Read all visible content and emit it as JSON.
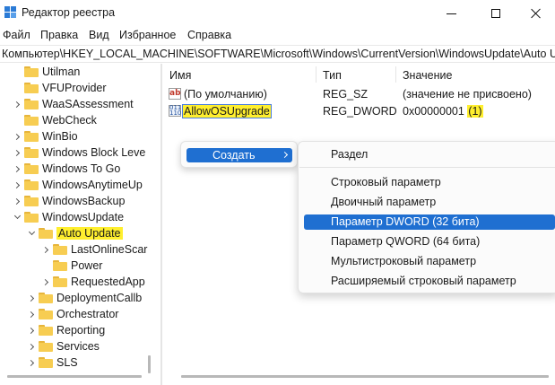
{
  "window": {
    "title": "Редактор реестра",
    "icon": "registry-editor-icon",
    "accent": "#1f6fd1"
  },
  "menu": [
    "Файл",
    "Правка",
    "Вид",
    "Избранное",
    "Справка"
  ],
  "address": "Компьютер\\HKEY_LOCAL_MACHINE\\SOFTWARE\\Microsoft\\Windows\\CurrentVersion\\WindowsUpdate\\Auto Update",
  "tree": {
    "items": [
      {
        "label": "Utilman"
      },
      {
        "label": "VFUProvider"
      },
      {
        "label": "WaaSAssessment"
      },
      {
        "label": "WebCheck"
      },
      {
        "label": "WinBio"
      },
      {
        "label": "Windows Block Leve"
      },
      {
        "label": "Windows To Go"
      },
      {
        "label": "WindowsAnytimeUp"
      },
      {
        "label": "WindowsBackup"
      },
      {
        "label": "WindowsUpdate"
      },
      {
        "label": "Auto Update"
      },
      {
        "label": "LastOnlineScar"
      },
      {
        "label": "Power"
      },
      {
        "label": "RequestedApp"
      },
      {
        "label": "DeploymentCallb"
      },
      {
        "label": "Orchestrator"
      },
      {
        "label": "Reporting"
      },
      {
        "label": "Services"
      },
      {
        "label": "SLS"
      }
    ],
    "selected_highlight": "#ffef2e"
  },
  "list": {
    "columns": [
      "Имя",
      "Тип",
      "Значение"
    ],
    "rows": [
      {
        "icon": "string-value-icon",
        "name": "(По умолчанию)",
        "type": "REG_SZ",
        "value": "(значение не присвоено)",
        "value_prefix": "",
        "value_highlight": "",
        "value_suffix": ""
      },
      {
        "icon": "binary-value-icon",
        "name": "AllowOSUpgrade",
        "type": "REG_DWORD",
        "value": "",
        "value_prefix": "0x00000001 ",
        "value_highlight": "(1)",
        "value_suffix": ""
      }
    ]
  },
  "context_menu": {
    "create_label": "Создать",
    "submenu": [
      "Раздел",
      "Строковый параметр",
      "Двоичный параметр",
      "Параметр DWORD (32 бита)",
      "Параметр QWORD (64 бита)",
      "Мультистроковый параметр",
      "Расширяемый строковый параметр"
    ],
    "active_item": "Параметр DWORD (32 бита)"
  }
}
